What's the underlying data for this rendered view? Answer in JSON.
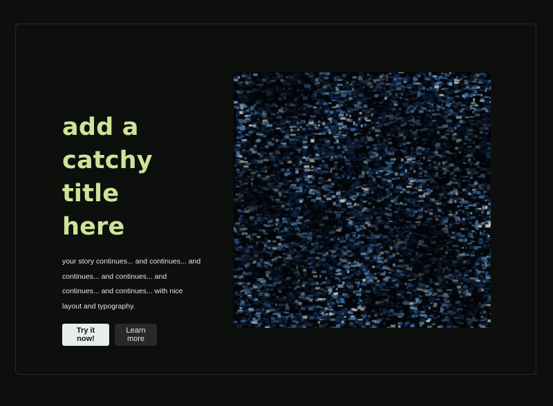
{
  "hero": {
    "title_lines": [
      "add a",
      "catchy title",
      "here"
    ],
    "body": "your story continues... and continues... and continues... and continues... and continues... and continues... with nice layout and typography.",
    "primary_button": "Try it now!",
    "secondary_button": "Learn more"
  },
  "colors": {
    "background": "#0d0f0c",
    "title": "#cfe398",
    "primary_button_bg": "#e9ecef",
    "secondary_button_bg": "#26282a"
  }
}
